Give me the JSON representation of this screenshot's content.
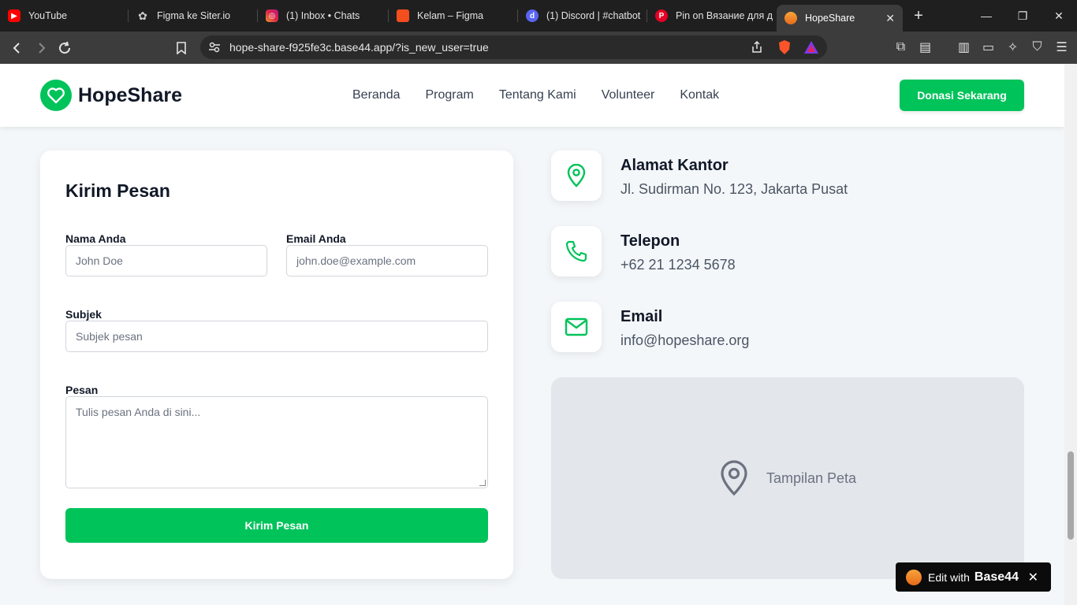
{
  "browser": {
    "tabs": [
      {
        "label": "YouTube",
        "icon": "youtube-icon",
        "color": "#ff0000"
      },
      {
        "label": "Figma ke Siter.io",
        "icon": "openai-icon",
        "color": "#5a5a5a"
      },
      {
        "label": "(1) Inbox • Chats",
        "icon": "instagram-icon",
        "color": "#d6249f"
      },
      {
        "label": "Kelam – Figma",
        "icon": "figma-icon",
        "color": "#f24e1e"
      },
      {
        "label": "(1) Discord | #chatbot",
        "icon": "discord-icon",
        "color": "#5865f2"
      },
      {
        "label": "Pin on Вязание для д",
        "icon": "pinterest-icon",
        "color": "#e60023"
      },
      {
        "label": "HopeShare",
        "icon": "hopeshare-tab-icon",
        "color": "#f28c28"
      }
    ],
    "url": "hope-share-f925fe3c.base44.app/?is_new_user=true"
  },
  "header": {
    "logo": "HopeShare",
    "nav": [
      "Beranda",
      "Program",
      "Tentang Kami",
      "Volunteer",
      "Kontak"
    ],
    "cta": "Donasi Sekarang"
  },
  "form": {
    "title": "Kirim Pesan",
    "name_label": "Nama Anda",
    "name_placeholder": "John Doe",
    "email_label": "Email Anda",
    "email_placeholder": "john.doe@example.com",
    "subject_label": "Subjek",
    "subject_placeholder": "Subjek pesan",
    "message_label": "Pesan",
    "message_placeholder": "Tulis pesan Anda di sini...",
    "submit": "Kirim Pesan"
  },
  "contact": {
    "address_title": "Alamat Kantor",
    "address_value": "Jl. Sudirman No. 123, Jakarta Pusat",
    "phone_title": "Telepon",
    "phone_value": "+62 21 1234 5678",
    "email_title": "Email",
    "email_value": "info@hopeshare.org"
  },
  "map": {
    "label": "Tampilan Peta"
  },
  "badge": {
    "prefix": "Edit with",
    "brand": "Base44"
  },
  "colors": {
    "accent": "#00c35a",
    "text": "#111827"
  }
}
